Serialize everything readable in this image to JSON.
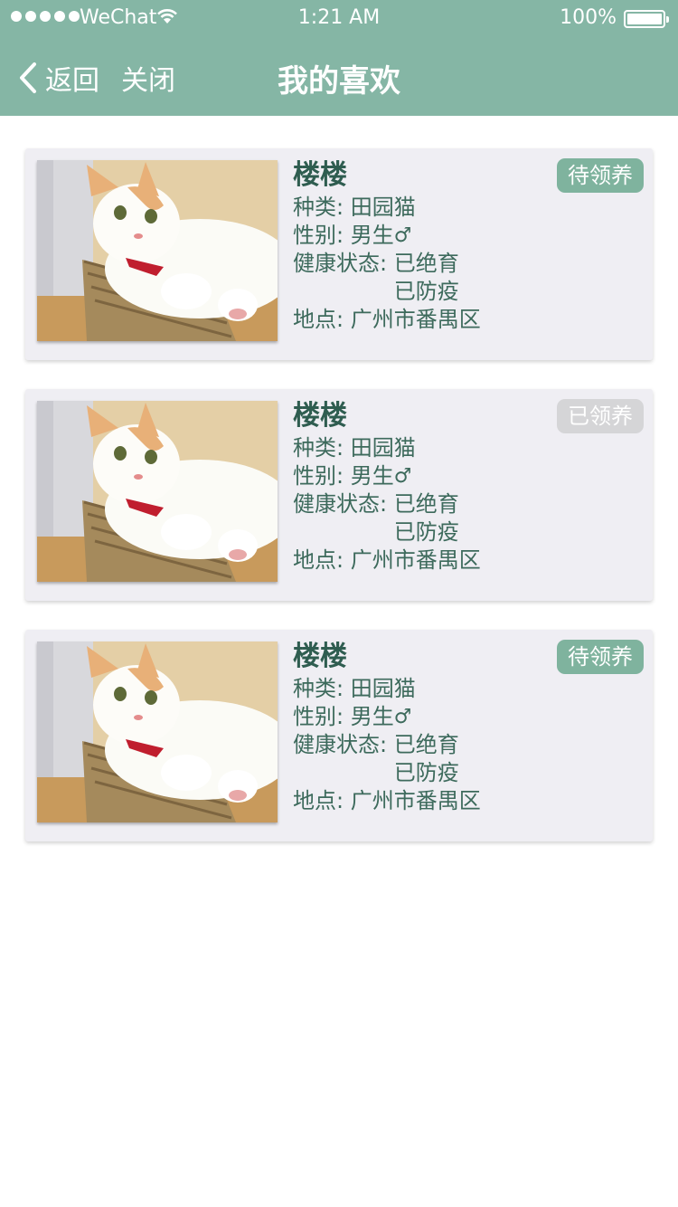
{
  "status": {
    "carrier": "WeChat",
    "time": "1:21 AM",
    "battery": "100%"
  },
  "nav": {
    "back": "返回",
    "close": "关闭",
    "title": "我的喜欢"
  },
  "pets": [
    {
      "name": "楼楼",
      "breed_label": "种类:",
      "breed": "田园猫",
      "sex_label": "性别:",
      "sex": "男生",
      "sex_icon": "♂",
      "health_label": "健康状态:",
      "health": [
        "已绝育",
        "已防疫"
      ],
      "location_label": "地点:",
      "location": "广州市番禺区",
      "status": "待领养",
      "status_type": "pending"
    },
    {
      "name": "楼楼",
      "breed_label": "种类:",
      "breed": "田园猫",
      "sex_label": "性别:",
      "sex": "男生",
      "sex_icon": "♂",
      "health_label": "健康状态:",
      "health": [
        "已绝育",
        "已防疫"
      ],
      "location_label": "地点:",
      "location": "广州市番禺区",
      "status": "已领养",
      "status_type": "done"
    },
    {
      "name": "楼楼",
      "breed_label": "种类:",
      "breed": "田园猫",
      "sex_label": "性别:",
      "sex": "男生",
      "sex_icon": "♂",
      "health_label": "健康状态:",
      "health": [
        "已绝育",
        "已防疫"
      ],
      "location_label": "地点:",
      "location": "广州市番禺区",
      "status": "待领养",
      "status_type": "pending"
    }
  ]
}
